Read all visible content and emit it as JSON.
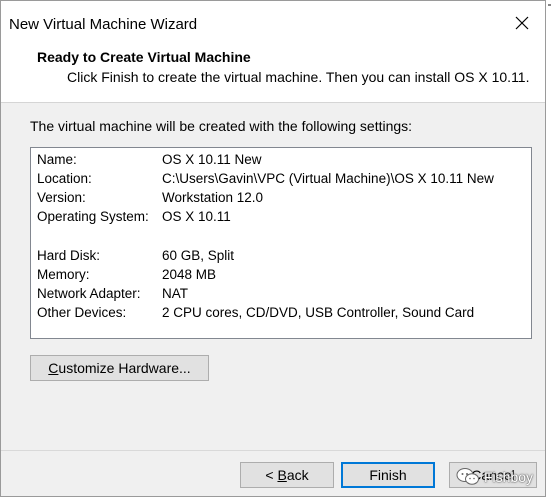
{
  "window": {
    "title": "New Virtual Machine Wizard"
  },
  "header": {
    "title": "Ready to Create Virtual Machine",
    "subtitle": "Click Finish to create the virtual machine. Then you can install OS X 10.11."
  },
  "intro_text": "The virtual machine will be created with the following settings:",
  "settings": [
    {
      "label": "Name:",
      "value": "OS X 10.11 New"
    },
    {
      "label": "Location:",
      "value": "C:\\Users\\Gavin\\VPC (Virtual Machine)\\OS X 10.11 New"
    },
    {
      "label": "Version:",
      "value": "Workstation 12.0"
    },
    {
      "label": "Operating System:",
      "value": "OS X 10.11"
    },
    {
      "label": "Hard Disk:",
      "value": "60 GB, Split"
    },
    {
      "label": "Memory:",
      "value": "2048 MB"
    },
    {
      "label": "Network Adapter:",
      "value": "NAT"
    },
    {
      "label": "Other Devices:",
      "value": "2 CPU cores, CD/DVD, USB Controller, Sound Card"
    }
  ],
  "buttons": {
    "customize_prefix": "C",
    "customize_rest": "ustomize Hardware...",
    "back_prefix": "< ",
    "back_mnemonic": "B",
    "back_rest": "ack",
    "finish": "Finish",
    "cancel": "Cancel"
  },
  "watermark": {
    "text": "Fishboy"
  },
  "colors": {
    "accent": "#0078d7",
    "dialog_bg": "#f0f0f0"
  },
  "icons": {
    "close": "close-icon",
    "watermark": "wechat-icon"
  }
}
